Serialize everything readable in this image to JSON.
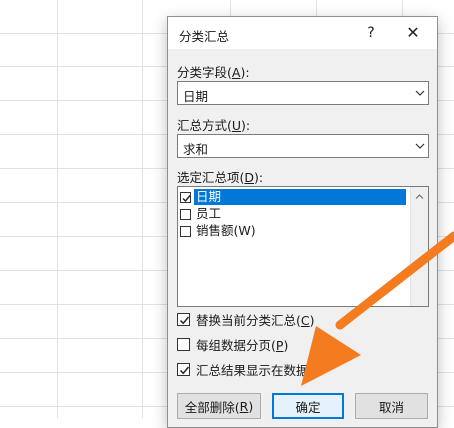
{
  "dialog": {
    "title": "分类汇总",
    "help_label": "?",
    "close_label": "✕",
    "group_by_label_prefix": "分类字段(",
    "group_by_label_key": "A",
    "group_by_label_suffix": "):",
    "group_by_value": "日期",
    "function_label_prefix": "汇总方式(",
    "function_label_key": "U",
    "function_label_suffix": "):",
    "function_value": "求和",
    "subtotal_label_prefix": "选定汇总项(",
    "subtotal_label_key": "D",
    "subtotal_label_suffix": "):",
    "subtotal_items": [
      {
        "label": "日期",
        "checked": true,
        "selected": true
      },
      {
        "label": "员工",
        "checked": false,
        "selected": false
      },
      {
        "label": "销售额(W)",
        "checked": false,
        "selected": false
      }
    ],
    "options": [
      {
        "prefix": "替换当前分类汇总(",
        "key": "C",
        "suffix": ")",
        "checked": true
      },
      {
        "prefix": "每组数据分页(",
        "key": "P",
        "suffix": ")",
        "checked": false
      },
      {
        "prefix": "汇总结果显示在数据下",
        "key": "",
        "suffix": "",
        "checked": true
      }
    ],
    "buttons": {
      "remove_prefix": "全部删除(",
      "remove_key": "R",
      "remove_suffix": ")",
      "ok": "确定",
      "cancel": "取消"
    }
  },
  "colors": {
    "accent": "#0078d7",
    "annotation_arrow": "#f47b20"
  }
}
